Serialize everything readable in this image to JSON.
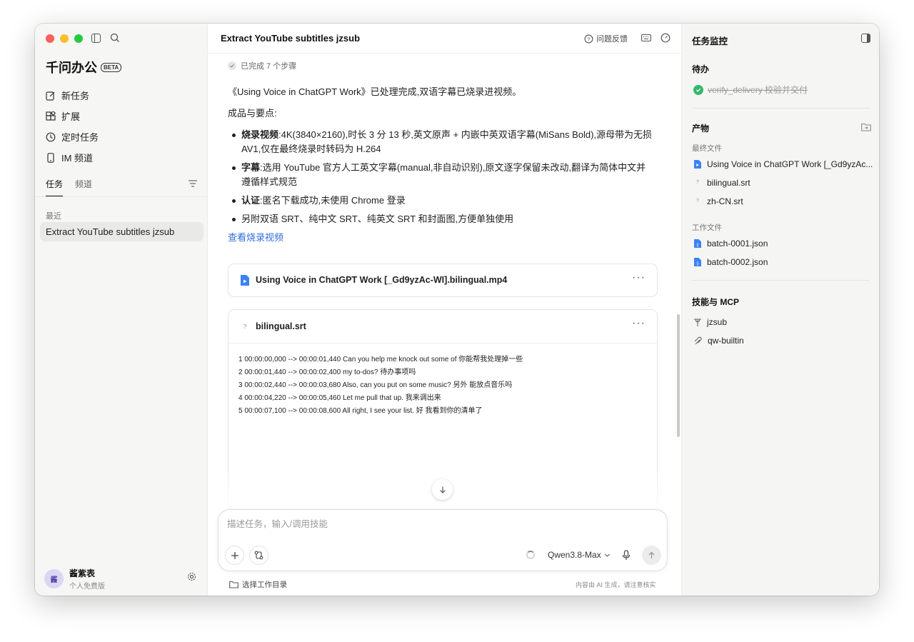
{
  "sidebar": {
    "brand": "千问办公",
    "beta": "BETA",
    "menu": [
      {
        "label": "新任务",
        "icon": "edit-icon"
      },
      {
        "label": "扩展",
        "icon": "extensions-icon"
      },
      {
        "label": "定时任务",
        "icon": "clock-icon"
      },
      {
        "label": "IM 频道",
        "icon": "phone-icon"
      }
    ],
    "tabs": [
      "任务",
      "频道"
    ],
    "recent_label": "最近",
    "recent_task": "Extract YouTube subtitles jzsub",
    "user": {
      "avatar": "酱",
      "name": "酱紫表",
      "plan": "个人免费版"
    }
  },
  "main": {
    "title": "Extract YouTube subtitles jzsub",
    "feedback_label": "问题反馈",
    "steps": "已完成 7 个步骤",
    "message": {
      "intro": "《Using Voice in ChatGPT Work》已处理完成,双语字幕已烧录进视频。",
      "section": "成品与要点:",
      "bullets": [
        {
          "bold": "烧录视频",
          "text": ":4K(3840×2160),时长 3 分 13 秒,英文原声 + 内嵌中英双语字幕(MiSans Bold),源母带为无损 AV1,仅在最终烧录时转码为 H.264"
        },
        {
          "bold": "字幕",
          "text": ":选用 YouTube 官方人工英文字幕(manual,非自动识别),原文逐字保留未改动,翻译为简体中文并遵循样式规范"
        },
        {
          "bold": "认证",
          "text": ":匿名下载成功,未使用 Chrome 登录"
        },
        {
          "bold": "",
          "text": "另附双语 SRT、纯中文 SRT、纯英文 SRT 和封面图,方便单独使用"
        }
      ],
      "link": "查看烧录视频"
    },
    "video_file": "Using Voice in ChatGPT Work [_Gd9yzAc-WI].bilingual.mp4",
    "srt_file": "bilingual.srt",
    "more": "···",
    "srt_lines": [
      "1 00:00:00,000 --> 00:00:01,440 Can you help me knock out some of 你能帮我处理掉一些",
      "2 00:00:01,440 --> 00:00:02,400 my to-dos? 待办事项吗",
      "3 00:00:02,440 --> 00:00:03,680 Also, can you put on some music? 另外 能放点音乐吗",
      "4 00:00:04,220 --> 00:00:05,460 Let me pull that up. 我来调出来",
      "5 00:00:07,100 --> 00:00:08,600 All right, I see your list. 好 我看到你的清单了"
    ],
    "composer": {
      "placeholder": "描述任务，输入/调用技能",
      "model": "Qwen3.8-Max"
    },
    "workdir": "选择工作目录",
    "disclaimer": "内容由 AI 生成，请注意核实"
  },
  "right_panel": {
    "title": "任务监控",
    "todo_title": "待办",
    "todo_item": "verify_delivery 校验并交付",
    "output_title": "产物",
    "final_label": "最终文件",
    "final_files": [
      "Using Voice in ChatGPT Work [_Gd9yzAc...",
      "bilingual.srt",
      "zh-CN.srt"
    ],
    "work_label": "工作文件",
    "work_files": [
      "batch-0001.json",
      "batch-0002.json"
    ],
    "skills_title": "技能与 MCP",
    "skills": [
      "jzsub",
      "qw-builtin"
    ]
  }
}
